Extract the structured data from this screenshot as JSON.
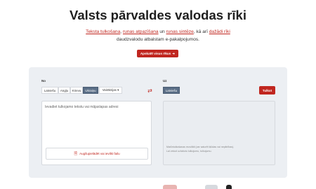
{
  "hero": {
    "title": "Valsts pārvaldes valodas rīki",
    "intro": {
      "link1": "Teksta tulkošana",
      "sep1": ", ",
      "link2": "runas atpazīšana",
      "text1": " un ",
      "link3": "runas sintēze",
      "text2": ", kā arī ",
      "link4": "dažādi rīki",
      "line2": "daudzvalodu atbalstam e-pakalpojumos."
    },
    "cta_label": "Apskatīt visus rīkus",
    "cta_icon": "arrow-right-icon"
  },
  "translator": {
    "from_label": "No",
    "to_label": "Uz",
    "source_langs": [
      "Latviešu",
      "Angļu",
      "Krievu",
      "Ukraiņu"
    ],
    "source_active": "Ukraiņu",
    "more_label": "Vairākrijas ▾",
    "target_langs": [
      "Latviešu"
    ],
    "target_active": "Latviešu",
    "swap_icon": "swap-arrows-icon",
    "translate_label": "Tulkot",
    "source_placeholder": "Ievadiet tulkojamo tekstu vai mājaslapas adresi",
    "upload_label": "Augšupielādēt vai ievilkt failu",
    "upload_icon": "file-upload-icon",
    "target_note": "Mašīntulkošanas rezultāti (var saturēt kļūdas vai nepilnības). Lai veicot uzlabotu tulkojumu, tulkojumu."
  },
  "colors": {
    "accent": "#c0261f",
    "active_tab": "#5a6e86",
    "panel_bg": "#eceff3"
  }
}
